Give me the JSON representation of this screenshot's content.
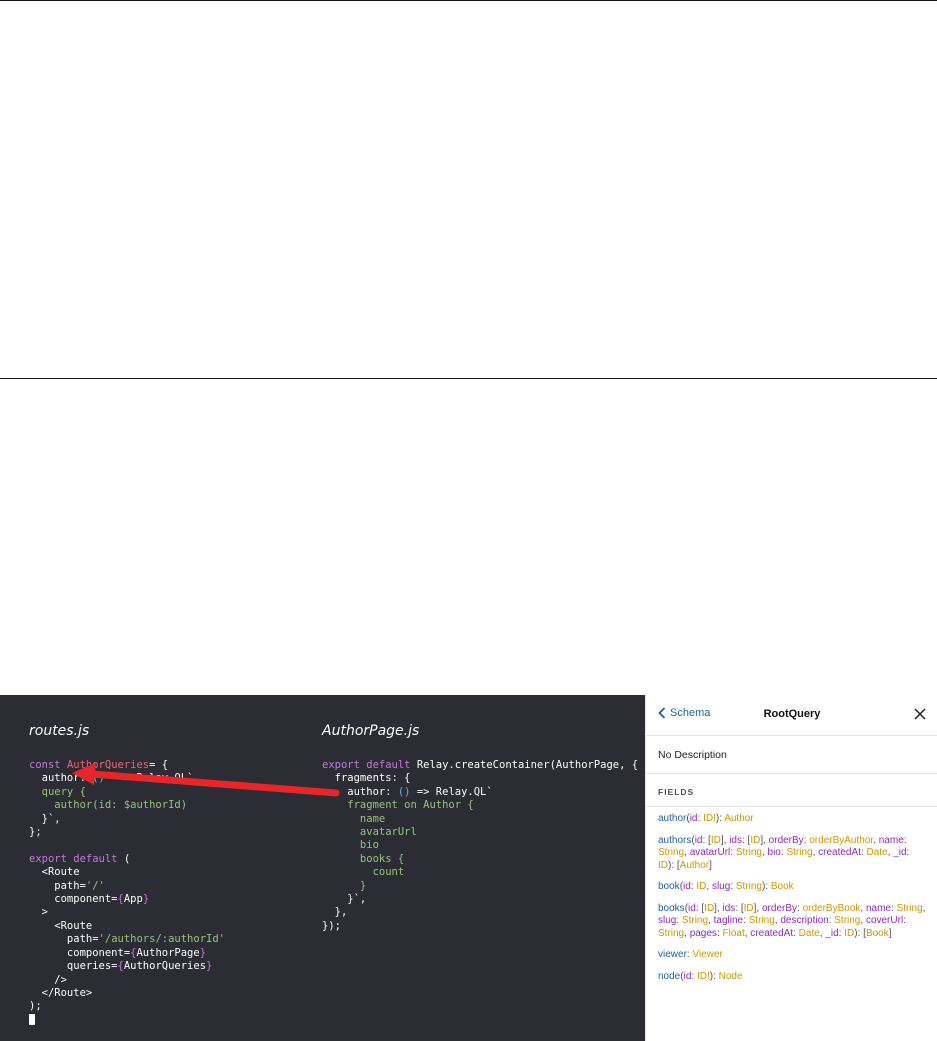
{
  "editor": {
    "file_left": "routes.js",
    "file_right": "AuthorPage.js",
    "routes_code": [
      [
        [
          "kw",
          "const "
        ],
        [
          "id",
          "AuthorQueries"
        ],
        [
          "",
          "= {"
        ]
      ],
      [
        [
          "",
          "  author: "
        ],
        [
          "bl",
          "()"
        ],
        [
          "",
          "  => Relay.QL`"
        ]
      ],
      [
        [
          "gr",
          "  query {"
        ]
      ],
      [
        [
          "gr",
          "    author(id: $authorId)"
        ]
      ],
      [
        [
          "",
          "  }`,"
        ]
      ],
      [
        [
          "",
          "};"
        ]
      ],
      [
        [
          "",
          ""
        ]
      ],
      [
        [
          "kw",
          "export default"
        ],
        [
          "",
          " ("
        ]
      ],
      [
        [
          "",
          "  <Route"
        ]
      ],
      [
        [
          "",
          "    path="
        ],
        [
          "gr",
          "'/'"
        ]
      ],
      [
        [
          "",
          "    component="
        ],
        [
          "pu",
          "{"
        ],
        [
          "",
          "App"
        ],
        [
          "pu",
          "}"
        ]
      ],
      [
        [
          "",
          "  >"
        ]
      ],
      [
        [
          "",
          "    <Route"
        ]
      ],
      [
        [
          "",
          "      path="
        ],
        [
          "gr",
          "'/authors/:authorId'"
        ]
      ],
      [
        [
          "",
          "      component="
        ],
        [
          "pu",
          "{"
        ],
        [
          "",
          "AuthorPage"
        ],
        [
          "pu",
          "}"
        ]
      ],
      [
        [
          "",
          "      queries="
        ],
        [
          "pu",
          "{"
        ],
        [
          "",
          "AuthorQueries"
        ],
        [
          "pu",
          "}"
        ]
      ],
      [
        [
          "",
          "    />"
        ]
      ],
      [
        [
          "",
          "  </Route>"
        ]
      ],
      [
        [
          "",
          ");"
        ]
      ]
    ],
    "author_code": [
      [
        [
          "kw",
          "export default "
        ],
        [
          "",
          "Relay.createContainer(AuthorPage, {"
        ]
      ],
      [
        [
          "",
          "  fragments: {"
        ]
      ],
      [
        [
          "",
          "    author: "
        ],
        [
          "bl",
          "()"
        ],
        [
          "",
          " => Relay.QL`"
        ]
      ],
      [
        [
          "gr",
          "    fragment on Author {"
        ]
      ],
      [
        [
          "gr",
          "      name"
        ]
      ],
      [
        [
          "gr",
          "      avatarUrl"
        ]
      ],
      [
        [
          "gr",
          "      bio"
        ]
      ],
      [
        [
          "gr",
          "      books {"
        ]
      ],
      [
        [
          "gr",
          "        count"
        ]
      ],
      [
        [
          "gr",
          "      }"
        ]
      ],
      [
        [
          "",
          "    }`,"
        ]
      ],
      [
        [
          "",
          "  },"
        ]
      ],
      [
        [
          "",
          "});"
        ]
      ]
    ],
    "arrow_color": "#e8262a"
  },
  "schema_panel": {
    "back_label": "Schema",
    "title": "RootQuery",
    "description": "No Description",
    "fields_heading": "FIELDS",
    "fields": [
      [
        [
          "fn",
          "author"
        ],
        [
          "p",
          "("
        ],
        [
          "arg",
          "id"
        ],
        [
          "p",
          ": "
        ],
        [
          "ty",
          "ID!"
        ],
        [
          "p",
          "): "
        ],
        [
          "ty",
          "Author"
        ]
      ],
      [
        [
          "fn",
          "authors"
        ],
        [
          "p",
          "("
        ],
        [
          "arg",
          "id"
        ],
        [
          "p",
          ": ["
        ],
        [
          "ty",
          "ID"
        ],
        [
          "p",
          "], "
        ],
        [
          "arg",
          "ids"
        ],
        [
          "p",
          ": ["
        ],
        [
          "ty",
          "ID"
        ],
        [
          "p",
          "], "
        ],
        [
          "arg",
          "orderBy"
        ],
        [
          "p",
          ": "
        ],
        [
          "ty",
          "orderByAuthor"
        ],
        [
          "p",
          ", "
        ],
        [
          "arg",
          "name"
        ],
        [
          "p",
          ": "
        ],
        [
          "ty",
          "String"
        ],
        [
          "p",
          ", "
        ],
        [
          "arg",
          "avatarUrl"
        ],
        [
          "p",
          ": "
        ],
        [
          "ty",
          "String"
        ],
        [
          "p",
          ", "
        ],
        [
          "arg",
          "bio"
        ],
        [
          "p",
          ": "
        ],
        [
          "ty",
          "String"
        ],
        [
          "p",
          ", "
        ],
        [
          "arg",
          "createdAt"
        ],
        [
          "p",
          ": "
        ],
        [
          "ty",
          "Date"
        ],
        [
          "p",
          ", "
        ],
        [
          "arg",
          "_id"
        ],
        [
          "p",
          ": "
        ],
        [
          "ty",
          "ID"
        ],
        [
          "p",
          "): ["
        ],
        [
          "ty",
          "Author"
        ],
        [
          "p",
          "]"
        ]
      ],
      [
        [
          "fn",
          "book"
        ],
        [
          "p",
          "("
        ],
        [
          "arg",
          "id"
        ],
        [
          "p",
          ": "
        ],
        [
          "ty",
          "ID"
        ],
        [
          "p",
          ", "
        ],
        [
          "arg",
          "slug"
        ],
        [
          "p",
          ": "
        ],
        [
          "ty",
          "String"
        ],
        [
          "p",
          "): "
        ],
        [
          "ty",
          "Book"
        ]
      ],
      [
        [
          "fn",
          "books"
        ],
        [
          "p",
          "("
        ],
        [
          "arg",
          "id"
        ],
        [
          "p",
          ": ["
        ],
        [
          "ty",
          "ID"
        ],
        [
          "p",
          "], "
        ],
        [
          "arg",
          "ids"
        ],
        [
          "p",
          ": ["
        ],
        [
          "ty",
          "ID"
        ],
        [
          "p",
          "], "
        ],
        [
          "arg",
          "orderBy"
        ],
        [
          "p",
          ": "
        ],
        [
          "ty",
          "orderByBook"
        ],
        [
          "p",
          ", "
        ],
        [
          "arg",
          "name"
        ],
        [
          "p",
          ": "
        ],
        [
          "ty",
          "String"
        ],
        [
          "p",
          ", "
        ],
        [
          "arg",
          "slug"
        ],
        [
          "p",
          ": "
        ],
        [
          "ty",
          "String"
        ],
        [
          "p",
          ", "
        ],
        [
          "arg",
          "tagline"
        ],
        [
          "p",
          ": "
        ],
        [
          "ty",
          "String"
        ],
        [
          "p",
          ", "
        ],
        [
          "arg",
          "description"
        ],
        [
          "p",
          ": "
        ],
        [
          "ty",
          "String"
        ],
        [
          "p",
          ", "
        ],
        [
          "arg",
          "coverUrl"
        ],
        [
          "p",
          ": "
        ],
        [
          "ty",
          "String"
        ],
        [
          "p",
          ", "
        ],
        [
          "arg",
          "pages"
        ],
        [
          "p",
          ": "
        ],
        [
          "ty",
          "Float"
        ],
        [
          "p",
          ", "
        ],
        [
          "arg",
          "createdAt"
        ],
        [
          "p",
          ": "
        ],
        [
          "ty",
          "Date"
        ],
        [
          "p",
          ", "
        ],
        [
          "arg",
          "_id"
        ],
        [
          "p",
          ": "
        ],
        [
          "ty",
          "ID"
        ],
        [
          "p",
          "): ["
        ],
        [
          "ty",
          "Book"
        ],
        [
          "p",
          "]"
        ]
      ],
      [
        [
          "fn",
          "viewer"
        ],
        [
          "p",
          ": "
        ],
        [
          "ty",
          "Viewer"
        ]
      ],
      [
        [
          "fn",
          "node"
        ],
        [
          "p",
          "("
        ],
        [
          "arg",
          "id"
        ],
        [
          "p",
          ": "
        ],
        [
          "ty",
          "ID!"
        ],
        [
          "p",
          "): "
        ],
        [
          "ty",
          "Node"
        ]
      ]
    ]
  }
}
